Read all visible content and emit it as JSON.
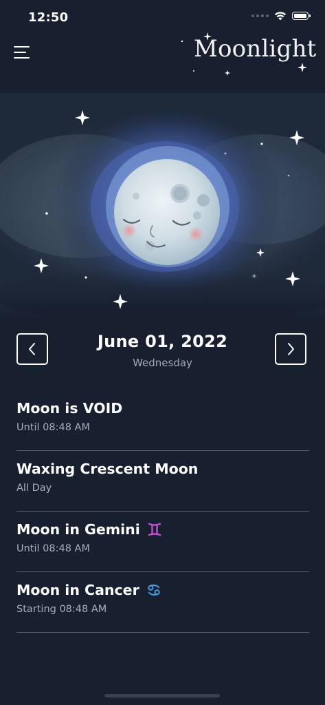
{
  "status_bar": {
    "time": "12:50",
    "icons": [
      "signal-icon",
      "wifi-icon",
      "battery-icon"
    ]
  },
  "header": {
    "brand": "Moonlight",
    "menu_icon": "hamburger-menu-icon"
  },
  "hero": {
    "illustration": "smiling-full-moon-illustration"
  },
  "date_nav": {
    "date": "June 01, 2022",
    "weekday": "Wednesday",
    "prev_icon": "chevron-left-icon",
    "next_icon": "chevron-right-icon"
  },
  "events": [
    {
      "title": "Moon is VOID",
      "subtitle": "Until 08:48 AM",
      "icon": ""
    },
    {
      "title": "Waxing Crescent Moon",
      "subtitle": "All Day",
      "icon": ""
    },
    {
      "title": "Moon in Gemini",
      "subtitle": "Until 08:48 AM",
      "icon": "gemini-icon"
    },
    {
      "title": "Moon in Cancer",
      "subtitle": "Starting 08:48 AM",
      "icon": "cancer-icon"
    }
  ],
  "colors": {
    "background": "#182030",
    "divider": "#5c6472",
    "muted_text": "#a9aeb8",
    "gemini": "#c34fd0",
    "cancer": "#4a9be0"
  }
}
